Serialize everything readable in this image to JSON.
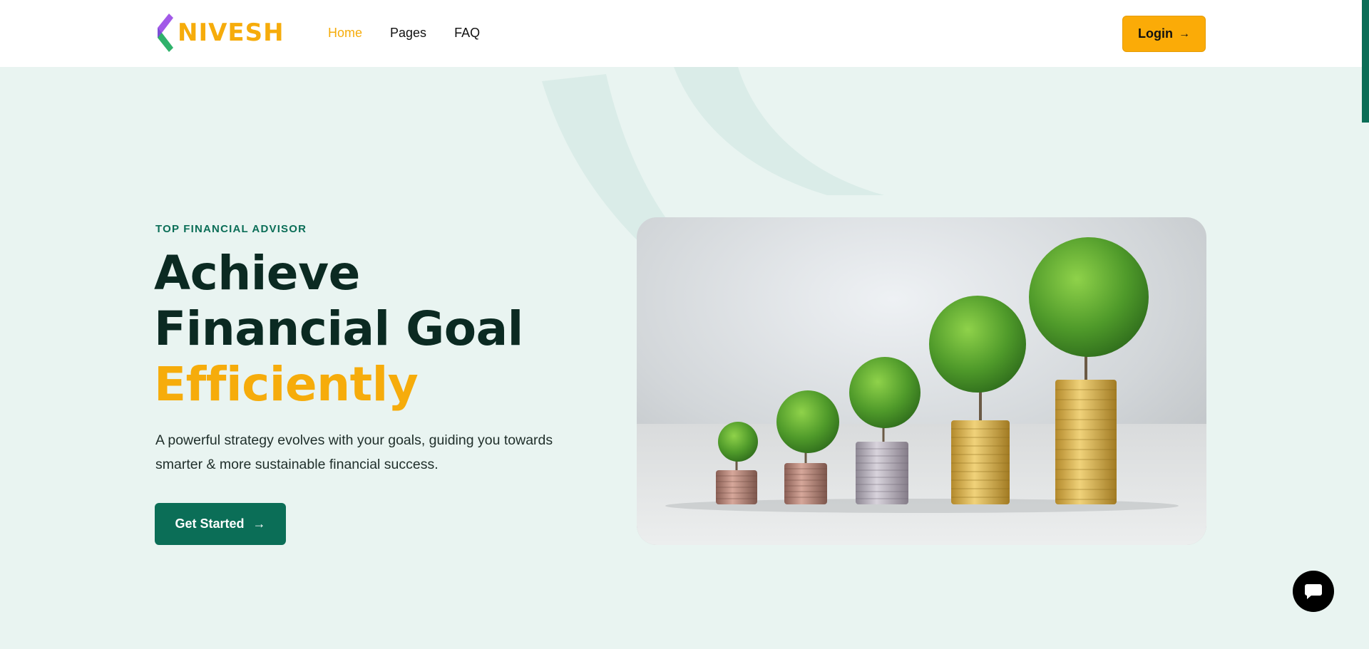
{
  "header": {
    "logo_text": "NIVESH",
    "nav": [
      {
        "label": "Home",
        "active": true
      },
      {
        "label": "Pages",
        "active": false
      },
      {
        "label": "FAQ",
        "active": false
      }
    ],
    "login_label": "Login"
  },
  "hero": {
    "eyebrow": "TOP FINANCIAL ADVISOR",
    "headline_line1": "Achieve",
    "headline_line2": "Financial Goal",
    "headline_accent": "Efficiently",
    "subtitle": "A powerful strategy evolves with your goals, guiding you towards smarter & more sustainable financial success.",
    "cta_label": "Get Started",
    "image_alt": "coin-stacks-with-growing-trees"
  },
  "colors": {
    "accent": "#f6ac0b",
    "primary": "#0b6e57",
    "background": "#e9f4f1",
    "heading": "#0b2a22"
  },
  "icons": {
    "login_arrow": "arrow-right-icon",
    "cta_arrow": "arrow-right-icon",
    "chat": "chat-bubble-icon"
  }
}
